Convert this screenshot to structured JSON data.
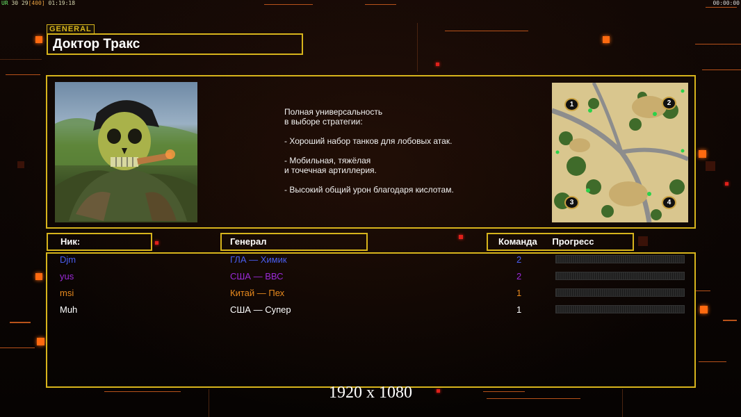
{
  "hud": {
    "left_prefix": "UR",
    "left_fps": "30",
    "left_fps_cap": "29",
    "left_bracket": "[400]",
    "left_time": "01:19:18",
    "right_time": "00:00:00"
  },
  "general": {
    "tag": "GENERAL",
    "name": "Доктор Тракс",
    "description": "Полная универсальность\nв выборе стратегии:\n\n- Хороший набор танков для лобовых атак.\n\n- Мобильная, тяжёлая\nи точечная артиллерия.\n\n- Высокий общий урон благодаря кислотам."
  },
  "minimap": {
    "start_positions": [
      "1",
      "2",
      "3",
      "4"
    ]
  },
  "table": {
    "headers": {
      "nick": "Ник:",
      "general": "Генерал",
      "team": "Команда",
      "progress": "Прогресс"
    },
    "rows": [
      {
        "nick": "Djm",
        "general": "ГЛА — Химик",
        "team": "2",
        "color": "#4a5ef0",
        "progress": 0
      },
      {
        "nick": "yus",
        "general": "США — ВВС",
        "team": "2",
        "color": "#9b2ad8",
        "progress": 0
      },
      {
        "nick": "msi",
        "general": "Китай — Пех",
        "team": "1",
        "color": "#e88a1e",
        "progress": 0
      },
      {
        "nick": "Muh",
        "general": "США — Супер",
        "team": "1",
        "color": "#ffffff",
        "progress": 0
      }
    ]
  },
  "resolution_note": "1920 x 1080",
  "colors": {
    "frame": "#d7b41c",
    "accent": "#ff6a10"
  }
}
